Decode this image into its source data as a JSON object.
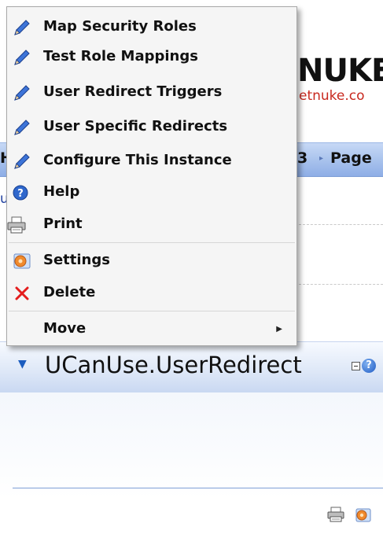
{
  "page": {
    "logo_text": "NUKE",
    "logo_url": "etnuke.co",
    "nav": {
      "left_fragment": "H",
      "number": "3",
      "page_label": "Page"
    },
    "left_fragment": "u"
  },
  "module": {
    "title": "UCanUse.UserRedirect"
  },
  "menu": {
    "items": [
      {
        "label": "Map Security Roles",
        "icon": "pencil-icon"
      },
      {
        "label": "Test Role Mappings",
        "icon": "pencil-icon"
      },
      {
        "label": "User Redirect Triggers",
        "icon": "pencil-icon"
      },
      {
        "label": "User Specific Redirects",
        "icon": "pencil-icon"
      },
      {
        "label": "Configure This Instance",
        "icon": "pencil-icon"
      },
      {
        "label": "Help",
        "icon": "help-icon"
      },
      {
        "label": "Print",
        "icon": "printer-icon"
      },
      {
        "label": "Settings",
        "icon": "settings-icon"
      },
      {
        "label": "Delete",
        "icon": "delete-icon"
      },
      {
        "label": "Move",
        "icon": ""
      }
    ]
  },
  "colors": {
    "nav_gradient": "#a7c1ec",
    "menu_background": "#f5f5f5",
    "delete_red": "#e41c1c",
    "link_blue": "#1f3f9f"
  }
}
